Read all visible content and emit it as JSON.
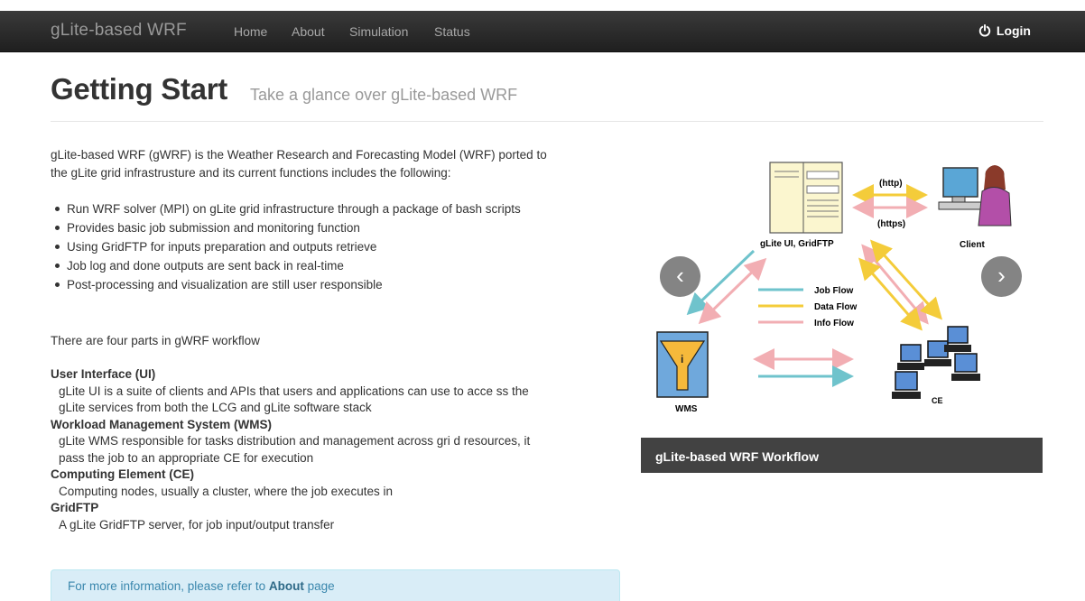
{
  "navbar": {
    "brand": "gLite-based WRF",
    "links": [
      "Home",
      "About",
      "Simulation",
      "Status"
    ],
    "login_label": "Login",
    "login_icon": "power-icon"
  },
  "header": {
    "title": "Getting Start",
    "subtitle": "Take a glance over gLite-based WRF"
  },
  "intro": {
    "line1": "gLite-based WRF (gWRF) is the Weather Research and Forecasting Model (WRF) ported to",
    "line2": "the gLite grid infrastrusture and its current functions includes the following:"
  },
  "features": [
    "Run WRF solver (MPI) on gLite grid infrastructure through a package of bash scripts",
    "Provides basic job submission and monitoring function",
    "Using GridFTP for inputs preparation and outputs retrieve",
    "Job log and done outputs are sent back in real-time",
    "Post-processing and visualization are still user responsible"
  ],
  "workflow_intro": "There are four parts in gWRF workflow",
  "parts": [
    {
      "title": "User Interface (UI)",
      "desc_line1": "gLite UI is a suite of clients and APIs that users and applications can use to acce ss the",
      "desc_line2": "gLite services from both the LCG and gLite software stack"
    },
    {
      "title": "Workload Management System (WMS)",
      "desc_line1": "gLite WMS responsible for tasks distribution and management across gri d resources, it",
      "desc_line2": "pass the job to an appropriate CE for execution"
    },
    {
      "title": "Computing Element (CE)",
      "desc_line1": "Computing nodes, usually a cluster, where the job executes in",
      "desc_line2": ""
    },
    {
      "title": "GridFTP",
      "desc_line1": "A gLite GridFTP server, for job input/output transfer",
      "desc_line2": ""
    }
  ],
  "alert": {
    "prefix": "For more information, please refer to ",
    "link": "About",
    "suffix": " page"
  },
  "carousel": {
    "caption": "gLite-based WRF Workflow",
    "prev": "‹",
    "next": "›",
    "diagram": {
      "label_ui": "gLite UI, GridFTP",
      "label_http": "(http)",
      "label_https": "(https)",
      "label_client": "Client",
      "label_wms": "WMS",
      "label_ce": "CE",
      "legend": [
        "Job Flow",
        "Data Flow",
        "Info Flow"
      ],
      "colors": {
        "job": "#6fc3cc",
        "data": "#f4cc3a",
        "info": "#f2aeb3"
      }
    }
  }
}
